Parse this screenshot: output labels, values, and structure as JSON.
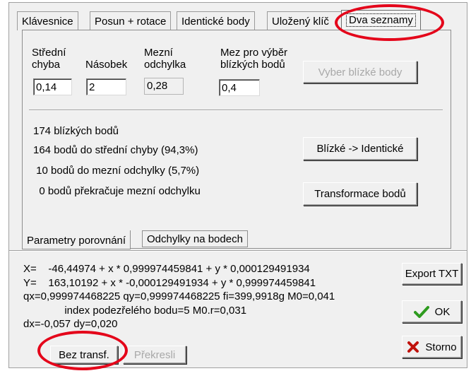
{
  "tabs": [
    "Klávesnice",
    "Posun + rotace",
    "Identické body",
    "Uložený klíč",
    "Dva seznamy"
  ],
  "params": {
    "stredni_label": [
      "Střední",
      "chyba"
    ],
    "nasobek_label": "Násobek",
    "mezni_label": [
      "Mezní",
      "odchylka"
    ],
    "mez_label": [
      "Mez pro výběr",
      "blízkých bodů"
    ],
    "stredni_value": "0,14",
    "nasobek_value": "2",
    "mezni_value": "0,28",
    "mez_value": "0,4"
  },
  "buttons": {
    "vyber": "Vyber blízké body",
    "blizke": "Blízké -> Identické",
    "transformace": "Transformace bodů",
    "export": "Export TXT",
    "ok": "OK",
    "storno": "Storno",
    "bez_transf": "Bez transf.",
    "prekresli": "Překresli"
  },
  "stats": [
    "174 blízkých bodů",
    "164 bodů do střední chyby (94,3%)",
    " 10 bodů do mezní odchylky (5,7%)",
    "  0 bodů překračuje mezní odchylku"
  ],
  "subtabs": [
    "Parametry porovnání",
    "Odchylky na bodech"
  ],
  "results": [
    "X=    -46,44974 + x * 0,999974459841 + y * 0,000129491934",
    "Y=    163,10192 + x * -0,000129491934 + y * 0,999974459841",
    "qx=0,999974468225 qy=0,999974468225 fi=399,9918g M0=0,041",
    "              index podezřelého bodu=5 M0.r=0,031",
    "dx=-0,057 dy=0,020"
  ],
  "colors": {
    "highlight": "#e4041a",
    "ok_check": "#2e9b1f",
    "storno_x": "#c0120c"
  },
  "icons": {
    "ok": "check-icon",
    "storno": "x-icon"
  }
}
